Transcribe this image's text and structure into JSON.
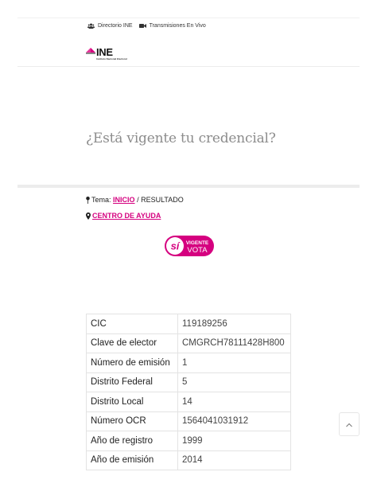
{
  "header": {
    "links": [
      {
        "label": "Directorio INE",
        "icon": "users-icon"
      },
      {
        "label": "Transmisiones En Vivo",
        "icon": "video-camera-icon"
      }
    ],
    "logo": {
      "name": "INE",
      "subtitle": "Instituto Nacional Electoral",
      "color": "#d5007f"
    }
  },
  "page": {
    "title": "¿Está vigente tu credencial?"
  },
  "breadcrumb": {
    "prefix": "Tema:",
    "link": "INICIO",
    "separator": "/",
    "current": "RESULTADO"
  },
  "help": {
    "label": "CENTRO DE AYUDA"
  },
  "badge": {
    "si": "sí",
    "line1": "VIGENTE",
    "line2": "VOTA",
    "color": "#d5007f"
  },
  "results": [
    {
      "label": "CIC",
      "value": "119189256"
    },
    {
      "label": "Clave de elector",
      "value": "CMGRCH78111428H800"
    },
    {
      "label": "Número de emisión",
      "value": "1"
    },
    {
      "label": "Distrito Federal",
      "value": "5"
    },
    {
      "label": "Distrito Local",
      "value": "14"
    },
    {
      "label": "Número OCR",
      "value": "1564041031912"
    },
    {
      "label": "Año de registro",
      "value": "1999"
    },
    {
      "label": "Año de emisión",
      "value": "2014"
    }
  ],
  "colors": {
    "accent": "#d5007f",
    "title": "#8c8c8c"
  }
}
